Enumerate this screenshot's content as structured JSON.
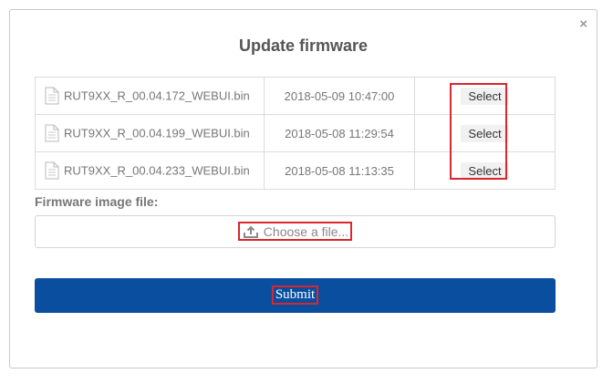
{
  "dialog": {
    "title": "Update firmware",
    "close_glyph": "×"
  },
  "files": [
    {
      "name": "RUT9XX_R_00.04.172_WEBUI.bin",
      "date": "2018-05-09 10:47:00",
      "action": "Select"
    },
    {
      "name": "RUT9XX_R_00.04.199_WEBUI.bin",
      "date": "2018-05-08 11:29:54",
      "action": "Select"
    },
    {
      "name": "RUT9XX_R_00.04.233_WEBUI.bin",
      "date": "2018-05-08 11:13:35",
      "action": "Select"
    }
  ],
  "form": {
    "image_label": "Firmware image file:",
    "choose_label": "Choose a file...",
    "submit_label": "Submit"
  },
  "icons": {
    "file": "file-icon",
    "upload": "upload-icon",
    "close": "close-icon"
  },
  "colors": {
    "submit_bg": "#0a4f9f",
    "highlight": "#d9262f"
  }
}
